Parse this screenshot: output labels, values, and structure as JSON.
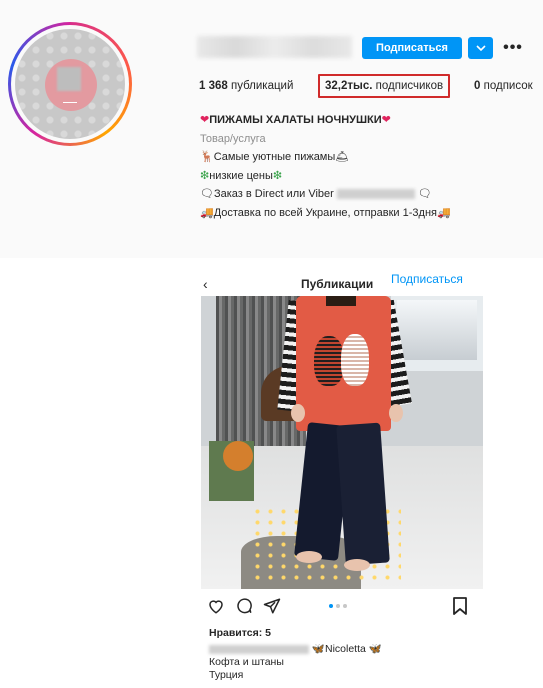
{
  "profile": {
    "follow_label": "Подписаться",
    "more_label": "•••",
    "stats": {
      "posts_count": "1 368",
      "posts_label": "публикаций",
      "followers_count": "32,2тыс.",
      "followers_label": "подписчиков",
      "following_count": "0",
      "following_label": "подписок"
    },
    "bio": {
      "title": "ПИЖАМЫ ХАЛАТЫ НОЧНУШКИ",
      "category": "Товар/услуга",
      "line1": "Самые уютные пижамы",
      "line2": "низкие цены",
      "line3": "Заказ в Direct или Viber",
      "line4": "Доставка по всей Украине, отправки 1-3дня"
    }
  },
  "post": {
    "back_label": "‹",
    "title": "Публикации",
    "follow_label": "Подписаться",
    "likes_label": "Нравится: 5",
    "caption_name": "Nicoletta",
    "caption_lines": [
      "Кофта и штаны",
      "Турция"
    ]
  },
  "colors": {
    "accent": "#0095f6",
    "highlight_border": "#d02a2a"
  },
  "icons": [
    "chevron-down-icon",
    "more-icon",
    "heart-icon",
    "comment-icon",
    "share-icon",
    "bookmark-icon",
    "back-icon"
  ]
}
